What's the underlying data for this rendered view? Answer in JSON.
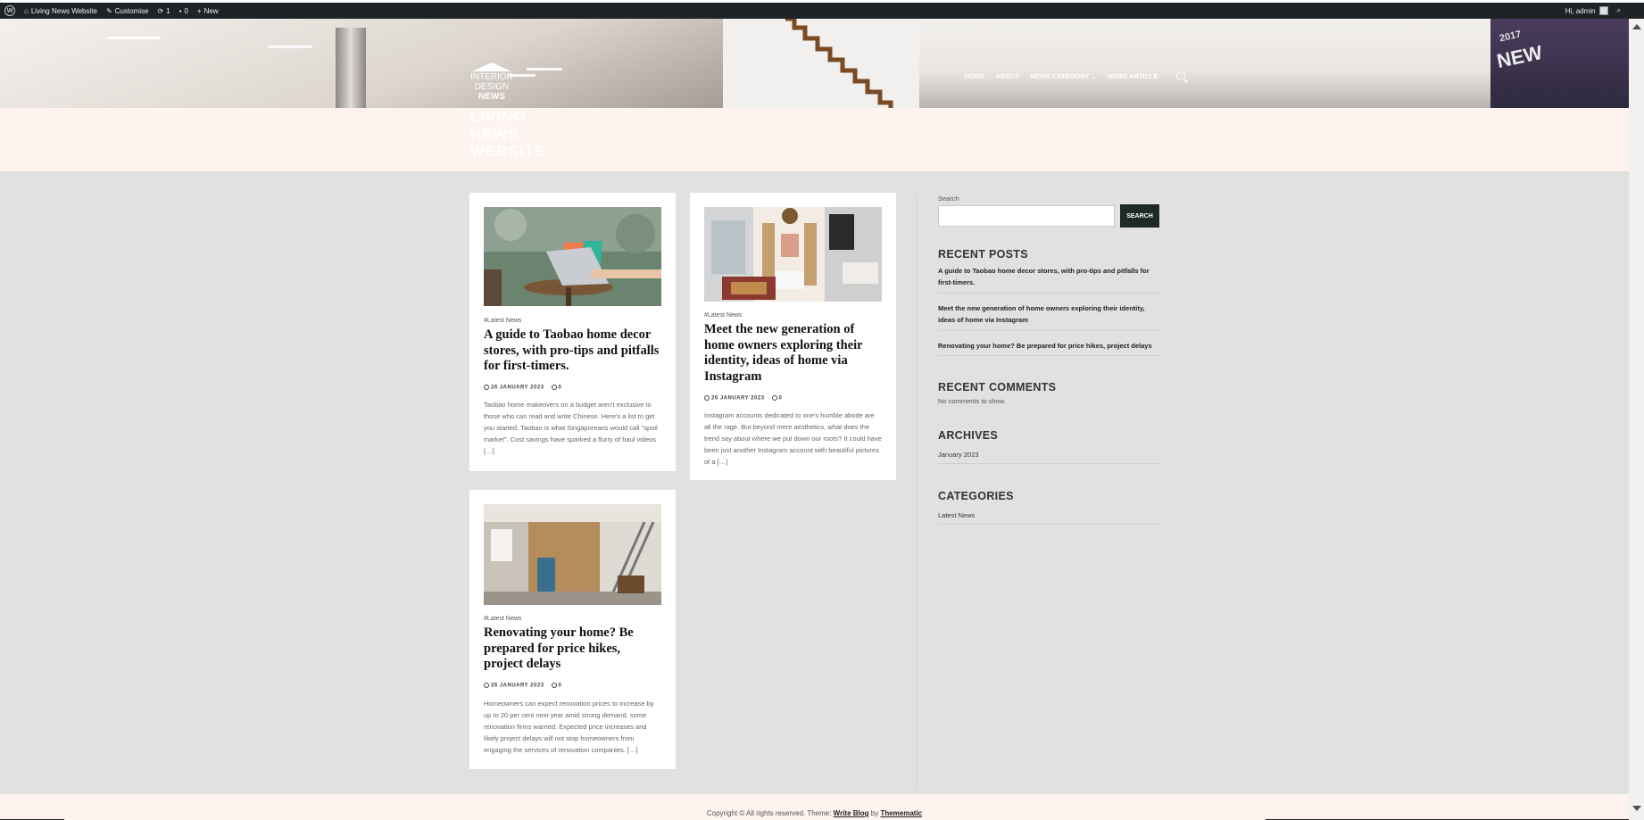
{
  "admin_bar": {
    "site_name": "Living News Website",
    "customise": "Customise",
    "updates_count": "1",
    "comments_count": "0",
    "new_label": "New",
    "greeting": "Hi, admin"
  },
  "header": {
    "logo": {
      "line1": "INTERIOR",
      "line2": "DESIGN",
      "line3": "NEWS"
    },
    "nav": [
      "HOME",
      "ABOUT",
      "NEWS CATEGORY",
      "NEWS ARTICLE"
    ],
    "nav_dropdown_icon": "chevron-down-icon",
    "search_icon": "search-icon",
    "sign_text": "NEW",
    "sign_year": "2017"
  },
  "site": {
    "title_lines": [
      "LIVING",
      "NEWS",
      "WEBSITE"
    ]
  },
  "posts": [
    {
      "category": "#Latest News",
      "title": "A guide to Taobao home decor stores, with pro-tips and pitfalls for first-timers.",
      "date": "26 JANUARY 2023",
      "comments": "0",
      "excerpt": "Taobao home makeovers on a budget aren't exclusive to those who can read and write Chinese. Here's a list to get you started. Taobao is what Singaporeans would call \"spoil market\". Cost savings have sparked a flurry of haul videos […]"
    },
    {
      "category": "#Latest News",
      "title": "Meet the new generation of home owners exploring their identity, ideas of home via Instagram",
      "date": "26 JANUARY 2023",
      "comments": "0",
      "excerpt": "Instagram accounts dedicated to one's humble abode are all the rage. But beyond mere aesthetics, what does the trend say about where we put down our roots? It could have been just another Instagram account with beautiful pictures of a […]"
    },
    {
      "category": "#Latest News",
      "title": "Renovating your home? Be prepared for price hikes, project delays",
      "date": "26 JANUARY 2023",
      "comments": "0",
      "excerpt": "Homeowners can expect renovation prices to increase by up to 20 per cent next year amid strong demand, some renovation firms warned. Expected price increases and likely project delays will not stop homeowners from engaging the services of renovation companies.  […]"
    }
  ],
  "sidebar": {
    "search_label": "Search",
    "search_button": "SEARCH",
    "recent_posts_heading": "RECENT POSTS",
    "recent_posts": [
      "A guide to Taobao home decor stores, with pro-tips and pitfalls for first-timers.",
      "Meet the new generation of home owners exploring their identity, ideas of home via Instagram",
      "Renovating your home? Be prepared for price hikes, project delays"
    ],
    "recent_comments_heading": "RECENT COMMENTS",
    "recent_comments_text": "No comments to show.",
    "archives_heading": "ARCHIVES",
    "archives": [
      "January 2023"
    ],
    "categories_heading": "CATEGORIES",
    "categories": [
      "Latest News"
    ]
  },
  "footer": {
    "copyright": "Copyright © All rights reserved. Theme: ",
    "theme_name": "Write Blog",
    "by": " by ",
    "author": "Themematic"
  }
}
